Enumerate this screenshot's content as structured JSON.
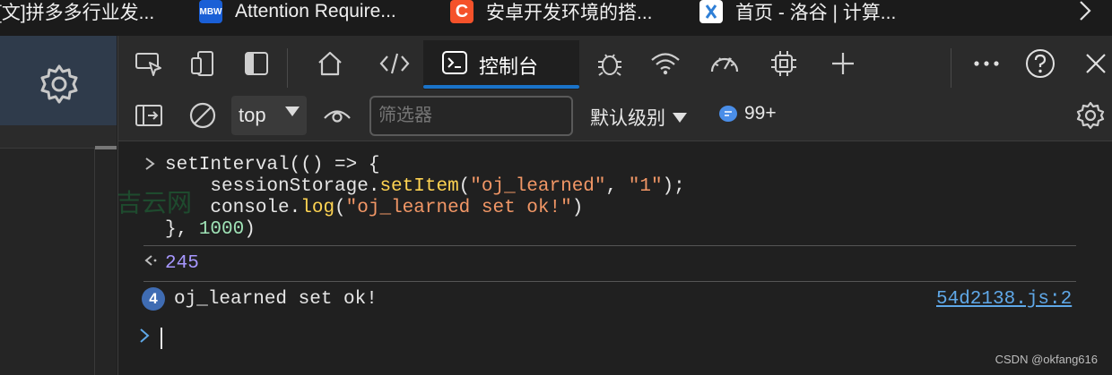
{
  "bookmarks": {
    "items": [
      {
        "label": "[文]拼多多行业发...",
        "icon": "bookmark-icon"
      },
      {
        "label": "Attention Require...",
        "icon": "mbw-logo-icon"
      },
      {
        "label": "安卓开发环境的搭...",
        "icon": "csdn-c-icon"
      },
      {
        "label": "首页 - 洛谷 | 计算...",
        "icon": "luogu-icon"
      }
    ],
    "more_icon": "chevron-right-icon"
  },
  "devtools": {
    "tabs": {
      "console_label": "控制台"
    },
    "console_toolbar": {
      "context": "top",
      "filter_placeholder": "筛选器",
      "level": "默认级别",
      "issues_count": "99+"
    },
    "console": {
      "code_lines": [
        {
          "parts": [
            {
              "t": "setInterval(() => {",
              "c": ""
            }
          ]
        },
        {
          "parts": [
            {
              "t": "    sessionStorage.",
              "c": ""
            },
            {
              "t": "setItem",
              "c": "fn"
            },
            {
              "t": "(",
              "c": ""
            },
            {
              "t": "\"oj_learned\"",
              "c": "str"
            },
            {
              "t": ", ",
              "c": ""
            },
            {
              "t": "\"1\"",
              "c": "str"
            },
            {
              "t": ");",
              "c": ""
            }
          ]
        },
        {
          "parts": [
            {
              "t": "    console.",
              "c": ""
            },
            {
              "t": "log",
              "c": "fn"
            },
            {
              "t": "(",
              "c": ""
            },
            {
              "t": "\"oj_learned set ok!\"",
              "c": "str"
            },
            {
              "t": ")",
              "c": ""
            }
          ]
        },
        {
          "parts": [
            {
              "t": "}, ",
              "c": ""
            },
            {
              "t": "1000",
              "c": "num"
            },
            {
              "t": ")",
              "c": ""
            }
          ]
        }
      ],
      "result_value": "245",
      "log_count": "4",
      "log_message": "oj_learned set ok!",
      "log_source": "54d2138.js:2"
    }
  },
  "watermark": "吉云网",
  "footer_credit": "CSDN @okfang616",
  "colors": {
    "accent": "#1a73c9",
    "string": "#f29766",
    "function": "#ffd452",
    "number": "#9fe3b6",
    "result": "#a797ff",
    "link": "#5fa8e8"
  }
}
